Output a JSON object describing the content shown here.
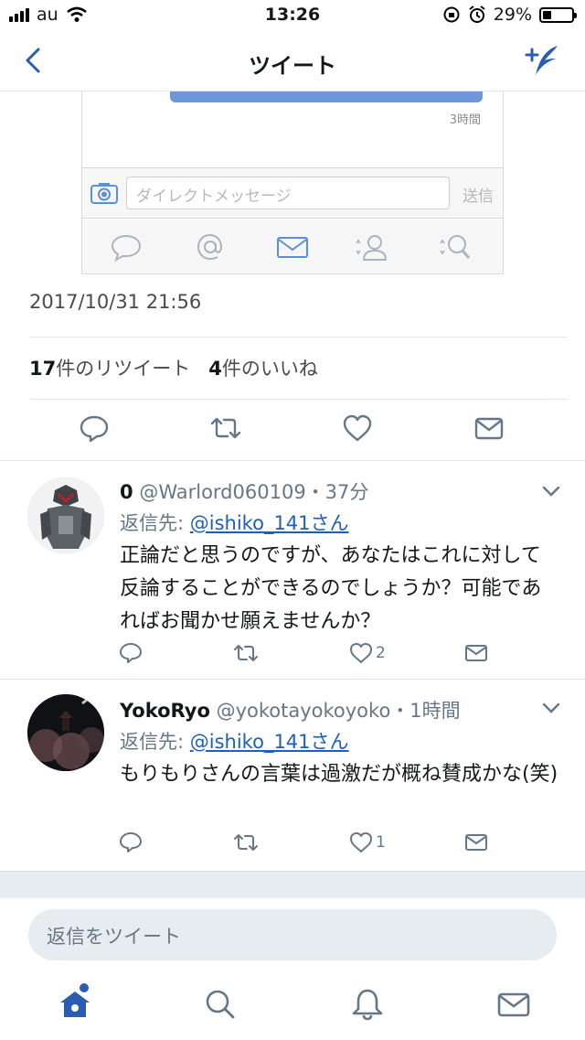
{
  "status_bar": {
    "carrier": "au",
    "time": "13:26",
    "battery": "29%",
    "battery_level": 0.29
  },
  "nav": {
    "title": "ツイート"
  },
  "embedded_image": {
    "time_label": "3時間",
    "dm_placeholder": "ダイレクトメッセージ",
    "send_label": "送信"
  },
  "tweet": {
    "timestamp": "2017/10/31 21:56",
    "retweet_count": "17",
    "retweet_label": "件のリツイート",
    "like_count": "4",
    "like_label": "件のいいね"
  },
  "replies": [
    {
      "name": "0",
      "handle_time": "@Warlord060109・37分",
      "reply_prefix": "返信先: ",
      "reply_to": "@ishiko_141さん",
      "text": "正論だと思うのですが、あなたはこれに対して反論することができるのでしょうか？可能であればお聞かせ願えませんか？",
      "like_count": "2"
    },
    {
      "name": "YokoRyo",
      "handle_time": "@yokotayokoyoko・1時間",
      "reply_prefix": "返信先: ",
      "reply_to": "@ishiko_141さん",
      "text": "もりもりさんの言葉は過激だが概ね賛成かな(笑)",
      "like_count": "1"
    }
  ],
  "compose": {
    "placeholder": "返信をツイート"
  },
  "colors": {
    "accent": "#2a5db0",
    "link": "#1b5fbf",
    "muted": "#657786"
  }
}
